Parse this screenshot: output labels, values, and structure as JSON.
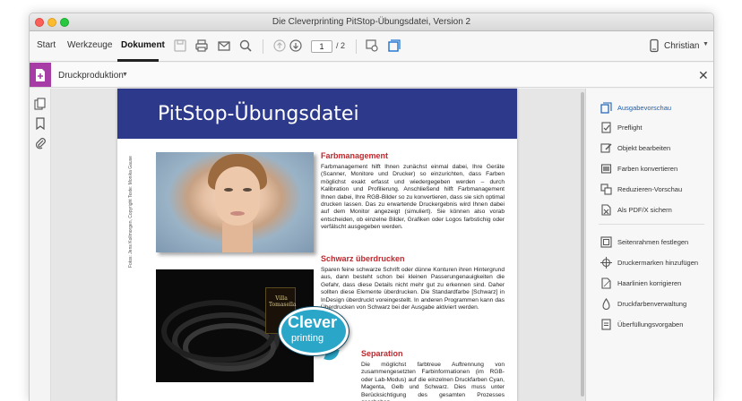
{
  "window": {
    "title": "Die Cleverprinting PitStop-Übungsdatei, Version 2"
  },
  "nav": {
    "tabs": [
      "Start",
      "Werkzeuge",
      "Dokument"
    ],
    "active_tab": "Dokument"
  },
  "toolbar": {
    "page_current": "1",
    "page_total": "/ 2",
    "user": "Christian",
    "icons": [
      "save-icon",
      "print-icon",
      "mail-icon",
      "search-icon",
      "page-up-icon",
      "page-down-icon",
      "select-tool-icon",
      "pitstop-tool-icon",
      "mobile-icon"
    ]
  },
  "tool_panel": {
    "title": "Druckproduktion"
  },
  "document": {
    "banner_title": "PitStop-Übungsdatei",
    "credit": "Fotos: Jens Kollmorgen, Copyright Texte: Monika Gause",
    "belt_box_label": "Villa Tomasella",
    "logo": {
      "top": "Clever",
      "bottom": "printing"
    },
    "sections": [
      {
        "heading": "Farbmanagement",
        "text": "Farbmanagement hilft Ihnen zunächst einmal dabei, Ihre Geräte (Scanner, Monitore und Drucker) so einzurichten, dass Farben möglichst exakt erfasst und wiedergegeben werden – durch Kalibration und Profilierung. Anschließend hilft Farbmanagement Ihnen dabei, Ihre RGB-Bilder so zu konvertieren, dass sie sich optimal drucken lassen. Das zu erwartende Druckergebnis wird Ihnen dabei auf dem Monitor angezeigt (simuliert). Sie können also vorab entscheiden, ob einzelne Bilder, Grafiken oder Logos farbstichig oder verfälscht ausgegeben werden."
      },
      {
        "heading": "Schwarz überdrucken",
        "text": "Sparen feine schwarze Schrift oder dünne Konturen ihren Hintergrund aus, dann besteht schon bei kleinen Passerungenauigkeiten die Gefahr, dass diese Details nicht mehr gut zu erkennen sind. Daher sollten diese Elemente überdrucken. Die Standardfarbe [Schwarz] in InDesign überdruckt voreingestellt. In anderen Programmen kann das Überdrucken von Schwarz bei der Ausgabe aktiviert werden."
      },
      {
        "heading": "Separation",
        "text": "Die möglichst farbtreue Auftrennung von zusammengesetzten Farbinformationen (im RGB- oder Lab-Modus) auf die einzelnen Druckfarben Cyan, Magenta, Gelb und Schwarz. Dies muss unter Berücksichtigung des gesamten Prozesses geschehen."
      }
    ]
  },
  "right_panel": {
    "items": [
      {
        "label": "Ausgabevorschau",
        "icon": "output-preview-icon",
        "active": true
      },
      {
        "label": "Preflight",
        "icon": "preflight-icon",
        "active": false
      },
      {
        "label": "Objekt bearbeiten",
        "icon": "edit-object-icon",
        "active": false
      },
      {
        "label": "Farben konvertieren",
        "icon": "convert-colors-icon",
        "active": false
      },
      {
        "label": "Reduzieren-Vorschau",
        "icon": "flattener-preview-icon",
        "active": false
      },
      {
        "label": "Als PDF/X sichern",
        "icon": "save-pdfx-icon",
        "active": false
      },
      {
        "label": "Seitenrahmen festlegen",
        "icon": "page-boxes-icon",
        "active": false
      },
      {
        "label": "Druckermarken hinzufügen",
        "icon": "printer-marks-icon",
        "active": false
      },
      {
        "label": "Haarlinien korrigieren",
        "icon": "fix-hairlines-icon",
        "active": false
      },
      {
        "label": "Druckfarbenverwaltung",
        "icon": "ink-manager-icon",
        "active": false
      },
      {
        "label": "Überfüllungsvorgaben",
        "icon": "trap-presets-icon",
        "active": false
      }
    ]
  },
  "colors": {
    "banner": "#2d3a8c",
    "heading": "#c0272d",
    "tool_badge": "#a83ca6",
    "active_link": "#1a5fb4"
  }
}
